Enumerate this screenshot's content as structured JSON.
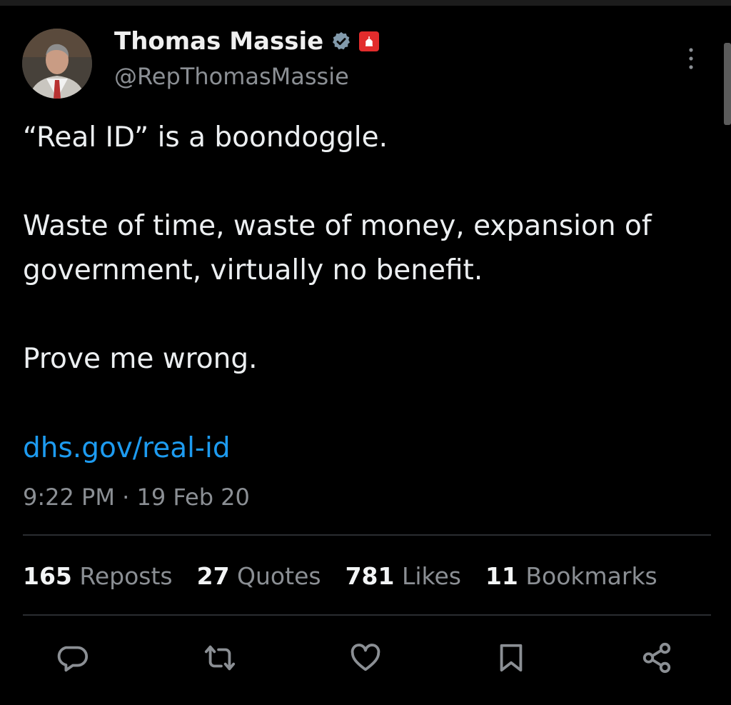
{
  "tweet": {
    "author_name": "Thomas Massie",
    "author_handle": "@RepThomasMassie",
    "paragraphs": [
      "“Real ID” is a boondoggle.",
      "Waste of time, waste of money, expansion of government, virtually no benefit.",
      "Prove me wrong."
    ],
    "link": "dhs.gov/real-id",
    "meta": "9:22 PM · 19 Feb 20"
  },
  "stats": [
    {
      "count": "165",
      "label": "Reposts"
    },
    {
      "count": "27",
      "label": "Quotes"
    },
    {
      "count": "781",
      "label": "Likes"
    },
    {
      "count": "11",
      "label": "Bookmarks"
    }
  ],
  "icons": {
    "verified": "verified-badge-icon",
    "affiliation": "affiliation-badge-icon",
    "more": "more-options-icon",
    "actions": [
      "reply-icon",
      "repost-icon",
      "like-icon",
      "bookmark-icon",
      "share-icon"
    ]
  },
  "colors": {
    "background": "#000000",
    "link": "#1d9bf0",
    "secondary_text": "#8b8f94",
    "primary_text": "#e7e9ea",
    "affiliation_badge": "#e22c2c"
  }
}
